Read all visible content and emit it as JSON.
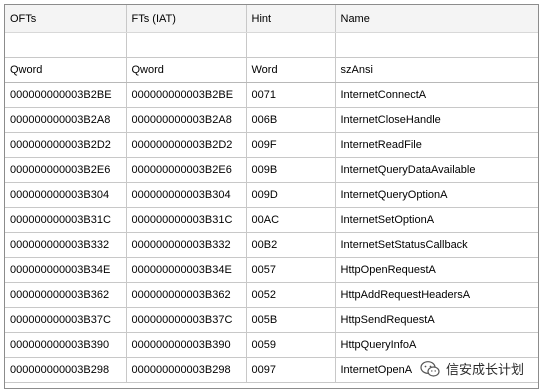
{
  "columns": [
    {
      "name": "OFTs",
      "type": "Qword"
    },
    {
      "name": "FTs (IAT)",
      "type": "Qword"
    },
    {
      "name": "Hint",
      "type": "Word"
    },
    {
      "name": "Name",
      "type": "szAnsi"
    }
  ],
  "rows": [
    [
      "000000000003B2BE",
      "000000000003B2BE",
      "0071",
      "InternetConnectA"
    ],
    [
      "000000000003B2A8",
      "000000000003B2A8",
      "006B",
      "InternetCloseHandle"
    ],
    [
      "000000000003B2D2",
      "000000000003B2D2",
      "009F",
      "InternetReadFile"
    ],
    [
      "000000000003B2E6",
      "000000000003B2E6",
      "009B",
      "InternetQueryDataAvailable"
    ],
    [
      "000000000003B304",
      "000000000003B304",
      "009D",
      "InternetQueryOptionA"
    ],
    [
      "000000000003B31C",
      "000000000003B31C",
      "00AC",
      "InternetSetOptionA"
    ],
    [
      "000000000003B332",
      "000000000003B332",
      "00B2",
      "InternetSetStatusCallback"
    ],
    [
      "000000000003B34E",
      "000000000003B34E",
      "0057",
      "HttpOpenRequestA"
    ],
    [
      "000000000003B362",
      "000000000003B362",
      "0052",
      "HttpAddRequestHeadersA"
    ],
    [
      "000000000003B37C",
      "000000000003B37C",
      "005B",
      "HttpSendRequestA"
    ],
    [
      "000000000003B390",
      "000000000003B390",
      "0059",
      "HttpQueryInfoA"
    ],
    [
      "000000000003B298",
      "000000000003B298",
      "0097",
      "InternetOpenA"
    ]
  ],
  "watermark": {
    "text": "信安成长计划",
    "icon": "wechat-icon"
  }
}
